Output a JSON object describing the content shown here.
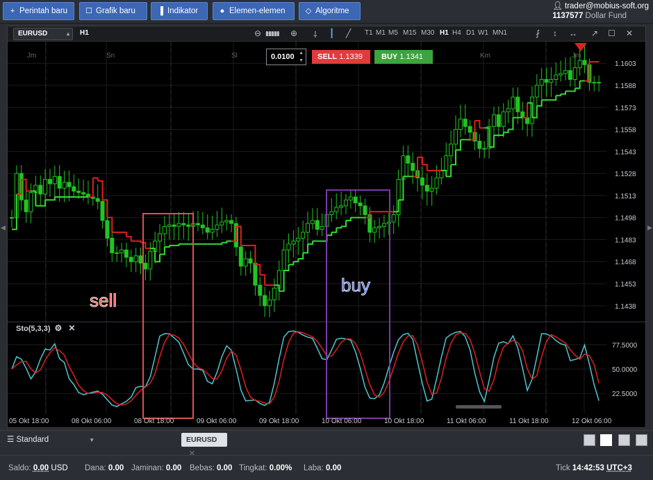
{
  "topbar": {
    "new_order": "Perintah baru",
    "new_chart": "Grafik baru",
    "indicators": "Indikator",
    "elements": "Elemen-elemen",
    "algorithm": "Algoritme",
    "icons": [
      "plus-icon",
      "chart-icon",
      "indicator-icon",
      "elements-icon",
      "algorithm-icon"
    ]
  },
  "account": {
    "email": "trader@mobius-soft.org",
    "id": "1137577",
    "fund": "Dollar Fund"
  },
  "chart": {
    "symbol": "EURUSD",
    "timeframe_current": "H1",
    "timeframes": [
      "T1",
      "M1",
      "M5",
      "M15",
      "M30",
      "H1",
      "H4",
      "D1",
      "W1",
      "MN1"
    ],
    "quantity": "0.0100",
    "sell_label": "SELL",
    "sell_price": "1.1339",
    "buy_label": "BUY",
    "buy_price": "1.1341",
    "day_labels": [
      "Jm",
      "Sn",
      "Sl",
      "Km",
      "Jm"
    ],
    "price_ticks": [
      "1.1603",
      "1.1588",
      "1.1573",
      "1.1558",
      "1.1543",
      "1.1528",
      "1.1513",
      "1.1498",
      "1.1483",
      "1.1468",
      "1.1453",
      "1.1438"
    ],
    "indicator_label": "Sto(5,3,3)",
    "osc_ticks": [
      "77.5000",
      "50.0000",
      "22.5000"
    ],
    "time_labels": [
      "05 Okt 18:00",
      "08 Okt 06:00",
      "08 Okt 18:00",
      "09 Okt 06:00",
      "09 Okt 18:00",
      "10 Okt 06:00",
      "10 Okt 18:00",
      "11 Okt 06:00",
      "11 Okt 18:00",
      "12 Okt 06:00"
    ],
    "annotations": {
      "sell": "sell",
      "buy": "buy"
    },
    "colors": {
      "up": "#22c322",
      "down": "#22c322",
      "trail_up": "#33dd33",
      "trail_down": "#e02020",
      "sto_k": "#4fc8d0",
      "sto_d": "#e02020",
      "sell_box": "#e05050",
      "buy_box": "#7a3aa8"
    }
  },
  "chart_data": {
    "type": "candlestick",
    "symbol": "EURUSD",
    "timeframe": "H1",
    "ylim": [
      1.1428,
      1.1613
    ],
    "close": [
      1.1498,
      1.1528,
      1.151,
      1.1502,
      1.1515,
      1.152,
      1.1514,
      1.1524,
      1.1521,
      1.1526,
      1.1518,
      1.1522,
      1.1519,
      1.1516,
      1.1515,
      1.1514,
      1.1512,
      1.1511,
      1.1509,
      1.1496,
      1.1484,
      1.1474,
      1.1474,
      1.1476,
      1.1471,
      1.1468,
      1.1472,
      1.1467,
      1.1463,
      1.1475,
      1.1482,
      1.1487,
      1.1492,
      1.1493,
      1.1492,
      1.1494,
      1.1493,
      1.1492,
      1.1494,
      1.1493,
      1.1491,
      1.1488,
      1.149,
      1.1493,
      1.1495,
      1.1496,
      1.1494,
      1.1478,
      1.1465,
      1.147,
      1.1467,
      1.1452,
      1.1445,
      1.1438,
      1.1442,
      1.145,
      1.1462,
      1.1476,
      1.148,
      1.1482,
      1.1484,
      1.1488,
      1.1494,
      1.1496,
      1.149,
      1.1492,
      1.15,
      1.1502,
      1.1505,
      1.1506,
      1.151,
      1.1512,
      1.1508,
      1.1506,
      1.15,
      1.1488,
      1.1491,
      1.1492,
      1.1494,
      1.1495,
      1.15,
      1.1524,
      1.154,
      1.1535,
      1.153,
      1.1525,
      1.152,
      1.1516,
      1.1518,
      1.1525,
      1.153,
      1.154,
      1.1548,
      1.1558,
      1.1565,
      1.156,
      1.1556,
      1.155,
      1.1545,
      1.1545,
      1.156,
      1.1568,
      1.156,
      1.157,
      1.1572,
      1.158,
      1.157,
      1.1566,
      1.1562,
      1.158,
      1.1588,
      1.1592,
      1.159,
      1.1592,
      1.1595,
      1.1596,
      1.1598,
      1.1592,
      1.16,
      1.1605,
      1.1602,
      1.159,
      1.159,
      1.159
    ]
  },
  "bottombar": {
    "workspace": "Standard",
    "tab": "EURUSD"
  },
  "status": {
    "saldo_label": "Saldo:",
    "saldo": "0.00",
    "currency": "USD",
    "dana_label": "Dana:",
    "dana": "0.00",
    "jaminan_label": "Jaminan:",
    "jaminan": "0.00",
    "bebas_label": "Bebas:",
    "bebas": "0.00",
    "tingkat_label": "Tingkat:",
    "tingkat": "0.00%",
    "laba_label": "Laba:",
    "laba": "0.00",
    "tick_label": "Tick",
    "time": "14:42:53",
    "tz": "UTC+3"
  }
}
